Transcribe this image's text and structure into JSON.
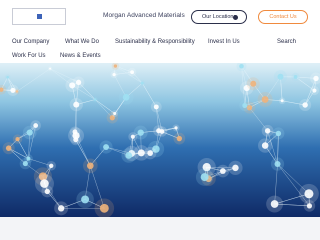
{
  "header": {
    "brand": "Morgan Advanced Materials",
    "locations_button": "Our Locations",
    "contact_button": "Contact Us"
  },
  "nav": {
    "items": [
      "Our Company",
      "What We Do",
      "Sustainability & Responsibility",
      "Invest In Us",
      "Search",
      "Work For Us",
      "News & Events"
    ]
  },
  "hero": {
    "image": "abstract blue network of connected glowing nodes",
    "colors": {
      "dark": "#0f2a66",
      "mid": "#2f6fb1",
      "light": "#bfe3f0",
      "glow_warm": "#f0b27a",
      "glow_cool": "#9fe0f2"
    }
  },
  "colors": {
    "accent": "#f08a3e",
    "text": "#2b2f4a",
    "brand_mark": "#3d63b8"
  }
}
